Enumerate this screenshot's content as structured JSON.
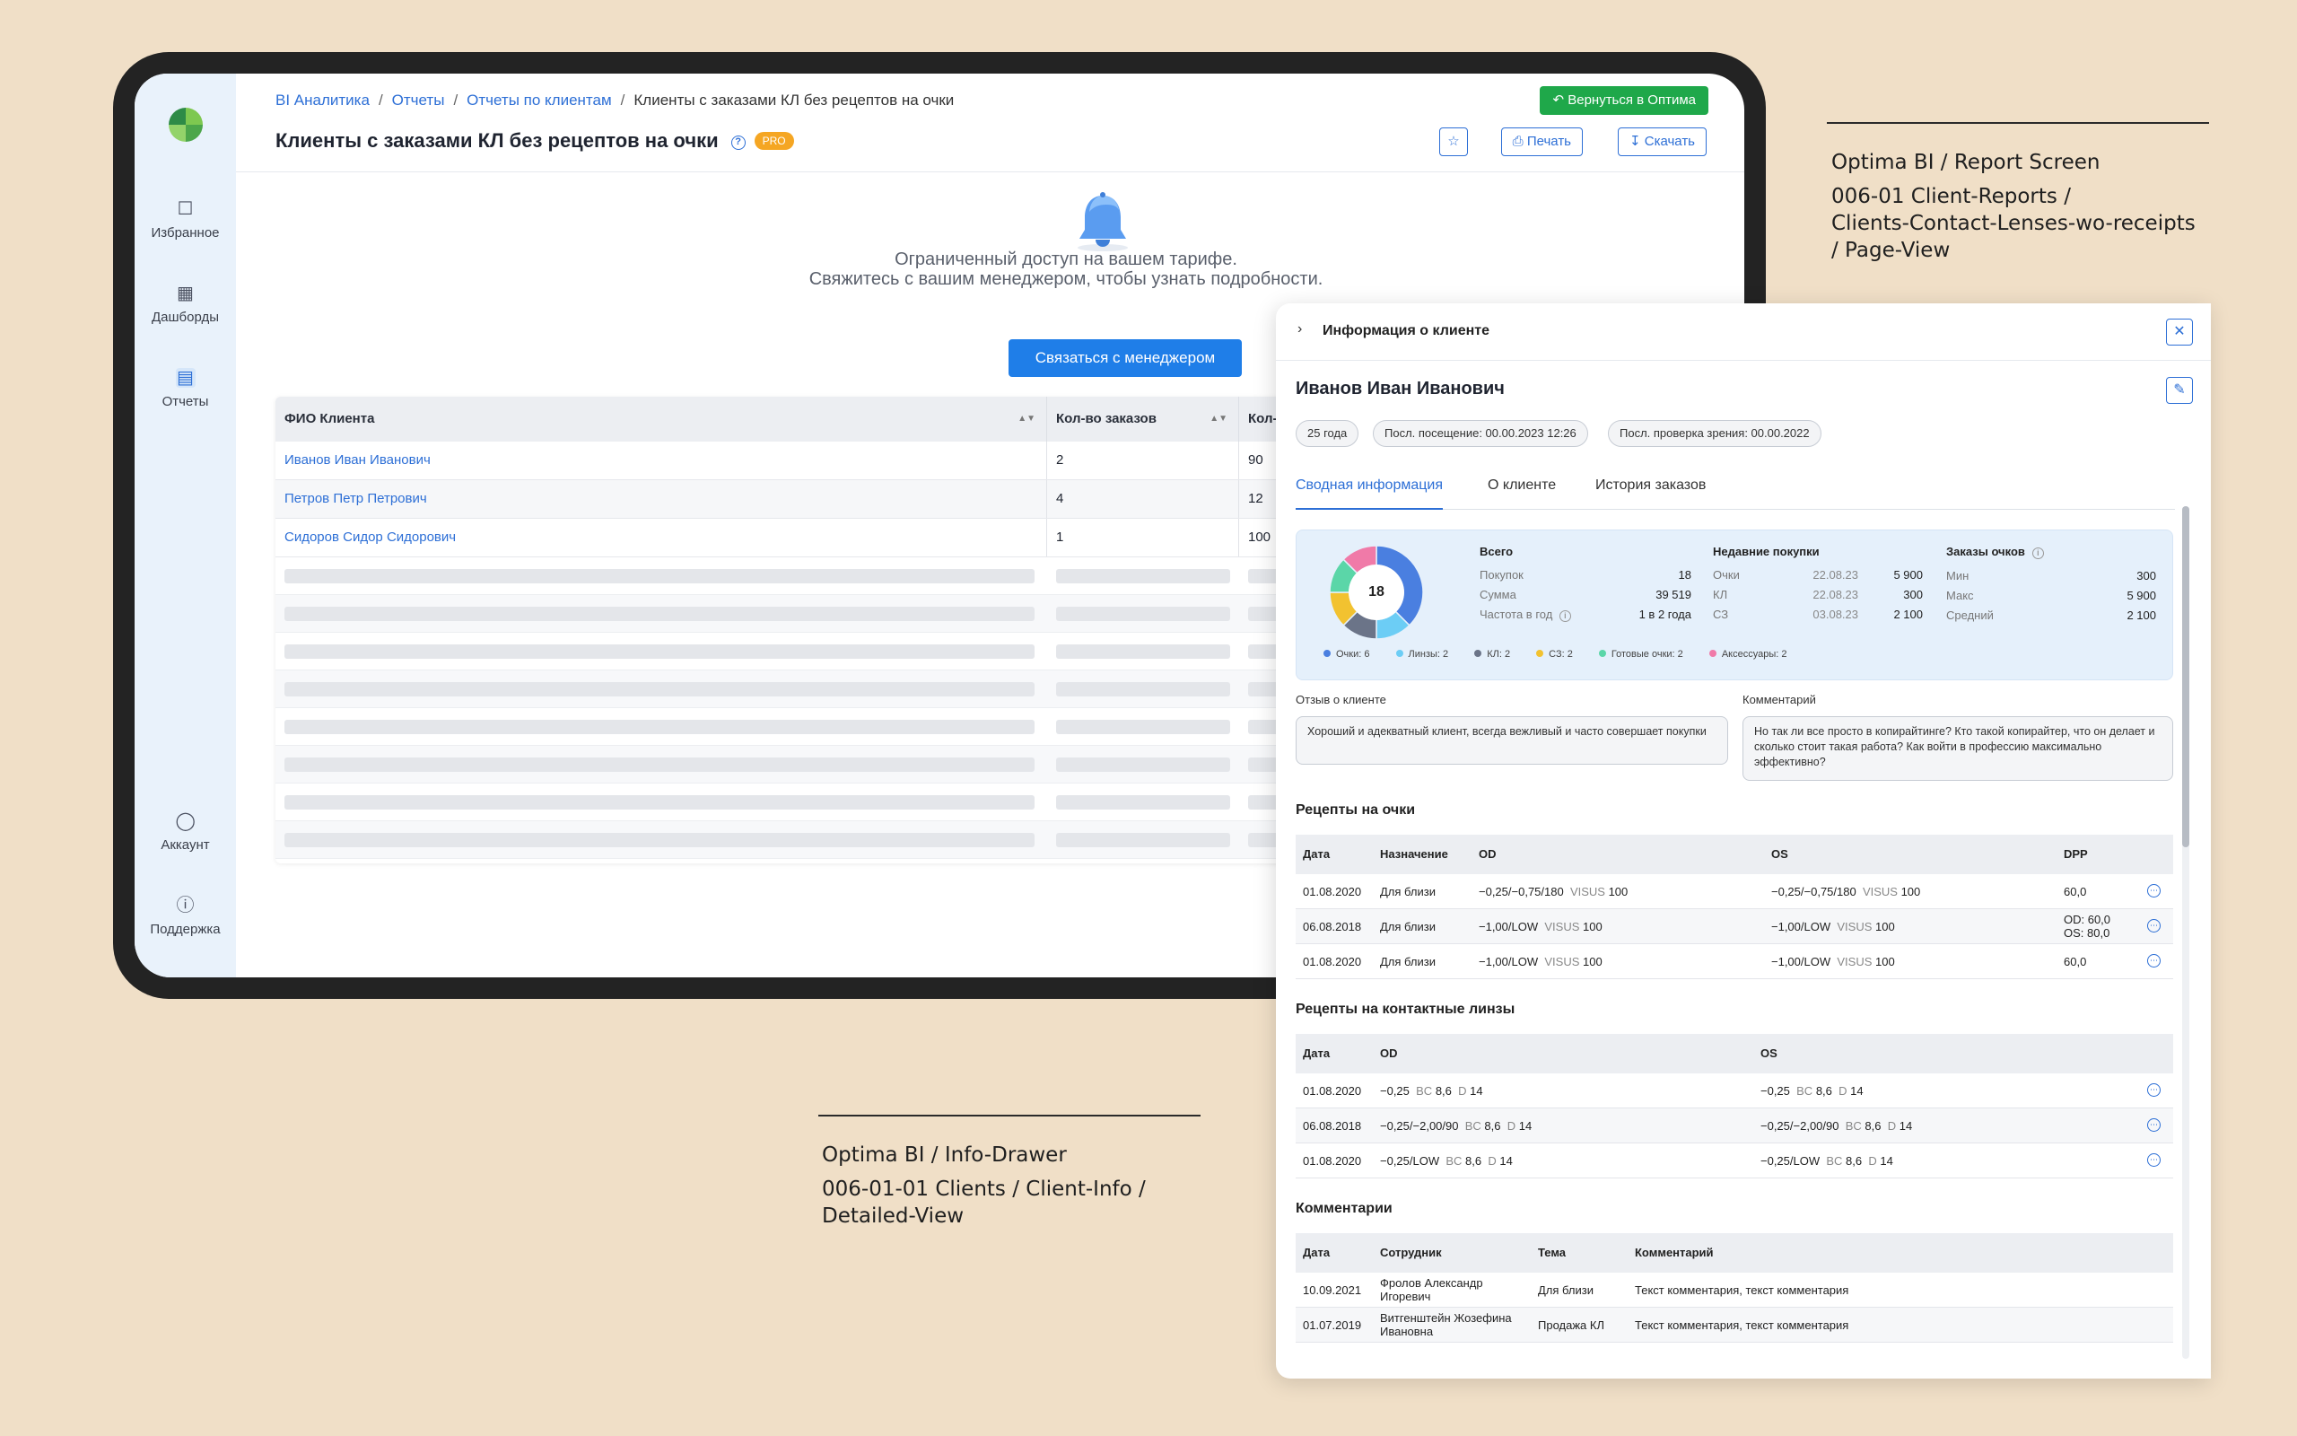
{
  "sidebar": {
    "items": [
      {
        "label": "Избранное",
        "icon": "bookmark-icon"
      },
      {
        "label": "Дашборды",
        "icon": "dashboard-icon"
      },
      {
        "label": "Отчеты",
        "icon": "table-icon"
      },
      {
        "label": "Аккаунт",
        "icon": "user-icon"
      },
      {
        "label": "Поддержка",
        "icon": "help-icon"
      }
    ]
  },
  "breadcrumb": [
    "BI Аналитика",
    "Отчеты",
    "Отчеты по клиентам",
    "Клиенты с заказами КЛ без рецептов на очки"
  ],
  "header": {
    "title": "Клиенты с заказами КЛ без рецептов на очки",
    "badge": "PRO",
    "return_label": "Вернуться в Оптима",
    "print_label": "Печать",
    "download_label": "Скачать"
  },
  "limit": {
    "line1": "Ограниченный доступ на вашем тарифе.",
    "line2": "Свяжитесь с вашим менеджером, чтобы узнать подробности.",
    "button": "Связаться с менеджером"
  },
  "report_table": {
    "columns": [
      "ФИО Клиента",
      "Кол-во заказов",
      "Кол-"
    ],
    "rows": [
      [
        "Иванов Иван Иванович",
        "2",
        "90"
      ],
      [
        "Петров Петр Петрович",
        "4",
        "12"
      ],
      [
        "Сидоров Сидор Сидорович",
        "1",
        "100"
      ]
    ]
  },
  "captions": {
    "report": [
      "Optima BI / Report Screen",
      "006-01 Client-Reports /",
      "Clients-Contact-Lenses-wo-receipts",
      "/ Page-View"
    ],
    "drawer": [
      "Optima BI / Info-Drawer",
      "006-01-01 Clients / Client-Info /",
      "Detailed-View"
    ]
  },
  "drawer": {
    "title": "Информация о клиенте",
    "client_name": "Иванов Иван Иванович",
    "chips": [
      "25 года",
      "Посл. посещение: 00.00.2023 12:26",
      "Посл. проверка зрения: 00.00.2022"
    ],
    "tabs": [
      "Сводная информация",
      "О клиенте",
      "История заказов"
    ],
    "summary": {
      "donut_total": "18",
      "total": {
        "header": "Всего",
        "rows": [
          [
            "Покупок",
            "18"
          ],
          [
            "Сумма",
            "39 519"
          ],
          [
            "Частота в год",
            "1 в 2 года"
          ]
        ]
      },
      "recent": {
        "header": "Недавние покупки",
        "rows": [
          [
            "Очки",
            "22.08.23",
            "5 900"
          ],
          [
            "КЛ",
            "22.08.23",
            "300"
          ],
          [
            "СЗ",
            "03.08.23",
            "2 100"
          ]
        ]
      },
      "glasses": {
        "header": "Заказы очков",
        "rows": [
          [
            "Мин",
            "300"
          ],
          [
            "Макс",
            "5 900"
          ],
          [
            "Средний",
            "2 100"
          ]
        ]
      },
      "legend": [
        {
          "label": "Очки: 6",
          "value": 6,
          "color": "#4a7fe0"
        },
        {
          "label": "Линзы: 2",
          "value": 2,
          "color": "#6ccdf5"
        },
        {
          "label": "КЛ: 2",
          "value": 2,
          "color": "#6b7488"
        },
        {
          "label": "СЗ: 2",
          "value": 2,
          "color": "#f2c230"
        },
        {
          "label": "Готовые очки: 2",
          "value": 2,
          "color": "#5bd6a8"
        },
        {
          "label": "Аксессуары: 2",
          "value": 2,
          "color": "#f07aa8"
        }
      ]
    },
    "review_label": "Отзыв о клиенте",
    "review_text": "Хороший и адекватный клиент, всегда вежливый и часто совершает покупки",
    "comment_label": "Комментарий",
    "comment_text": "Но так ли все просто в копирайтинге? Кто такой копирайтер, что он делает и сколько стоит такая работа? Как войти в профессию максимально эффективно?",
    "glasses_rx": {
      "title": "Рецепты на очки",
      "columns": [
        "Дата",
        "Назначение",
        "OD",
        "OS",
        "DPP"
      ],
      "rows": [
        {
          "date": "01.08.2020",
          "purpose": "Для близи",
          "od": "−0,25/−0,75/180",
          "os": "−0,25/−0,75/180",
          "dpp": "60,0"
        },
        {
          "date": "06.08.2018",
          "purpose": "Для близи",
          "od": "−1,00/LOW",
          "os": "−1,00/LOW",
          "dpp": "OD: 60,0",
          "dpp2": "OS: 80,0"
        },
        {
          "date": "01.08.2020",
          "purpose": "Для близи",
          "od": "−1,00/LOW",
          "os": "−1,00/LOW",
          "dpp": "60,0"
        }
      ],
      "visus_label": "VISUS",
      "visus_value": "100"
    },
    "cl_rx": {
      "title": "Рецепты на контактные линзы",
      "columns": [
        "Дата",
        "OD",
        "OS"
      ],
      "rows": [
        {
          "date": "01.08.2020",
          "od": "−0,25",
          "os": "−0,25"
        },
        {
          "date": "06.08.2018",
          "od": "−0,25/−2,00/90",
          "os": "−0,25/−2,00/90"
        },
        {
          "date": "01.08.2020",
          "od": "−0,25/LOW",
          "os": "−0,25/LOW"
        }
      ],
      "bc_label": "BC",
      "bc_value": "8,6",
      "d_label": "D",
      "d_value": "14"
    },
    "comments": {
      "title": "Комментарии",
      "columns": [
        "Дата",
        "Сотрудник",
        "Тема",
        "Комментарий"
      ],
      "rows": [
        {
          "date": "10.09.2021",
          "staff1": "Фролов Александр",
          "staff2": "Игоревич",
          "topic": "Для близи",
          "text": "Текст комментария, текст комментария"
        },
        {
          "date": "01.07.2019",
          "staff1": "Витгенштейн Жозефина",
          "staff2": "Ивановна",
          "topic": "Продажа КЛ",
          "text": "Текст комментария, текст комментария"
        }
      ]
    }
  }
}
